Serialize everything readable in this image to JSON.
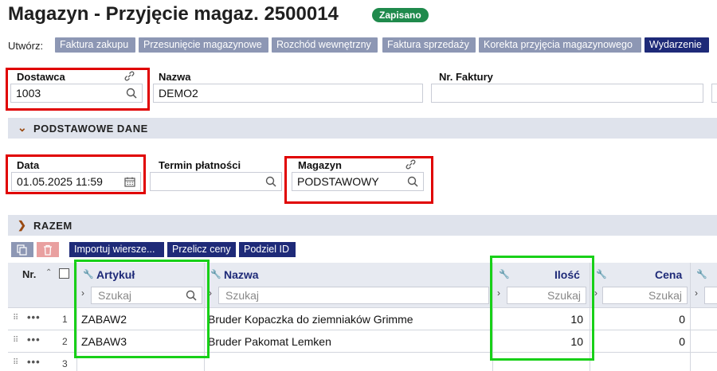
{
  "header": {
    "title": "Magazyn - Przyjęcie magaz. 2500014",
    "status": "Zapisano"
  },
  "create": {
    "label": "Utwórz:",
    "buttons": [
      "Faktura zakupu",
      "Przesunięcie magazynowe",
      "Rozchód wewnętrzny",
      "Faktura sprzedaży",
      "Korekta przyjęcia magazynowego",
      "Wydarzenie"
    ]
  },
  "fields": {
    "dostawca": {
      "label": "Dostawca",
      "value": "1003"
    },
    "nazwa": {
      "label": "Nazwa",
      "value": "DEMO2"
    },
    "nr_faktury": {
      "label": "Nr. Faktury",
      "value": ""
    },
    "data": {
      "label": "Data",
      "value": "01.05.2025 11:59"
    },
    "termin": {
      "label": "Termin płatności",
      "value": ""
    },
    "magazyn": {
      "label": "Magazyn",
      "value": "PODSTAWOWY"
    }
  },
  "sections": {
    "podstawowe": "PODSTAWOWE DANE",
    "razem": "RAZEM"
  },
  "toolbar": {
    "import": "Importuj wiersze...",
    "recalc": "Przelicz ceny",
    "split": "Podziel ID"
  },
  "table": {
    "columns": {
      "nr": "Nr.",
      "artykul": "Artykuł",
      "nazwa": "Nazwa",
      "ilosc": "Ilość",
      "cena": "Cena"
    },
    "search_placeholder": "Szukaj",
    "rows": [
      {
        "nr": "1",
        "artykul": "ZABAW2",
        "nazwa": "Bruder Kopaczka do ziemniaków Grimme",
        "ilosc": "10",
        "cena": "0"
      },
      {
        "nr": "2",
        "artykul": "ZABAW3",
        "nazwa": "Bruder Pakomat Lemken",
        "ilosc": "10",
        "cena": "0"
      },
      {
        "nr": "3",
        "artykul": "",
        "nazwa": "",
        "ilosc": "",
        "cena": ""
      }
    ]
  },
  "colors": {
    "accent": "#1e2a78",
    "saved": "#1f8a4c",
    "highlight_red": "#e00000",
    "highlight_green": "#18d018"
  }
}
